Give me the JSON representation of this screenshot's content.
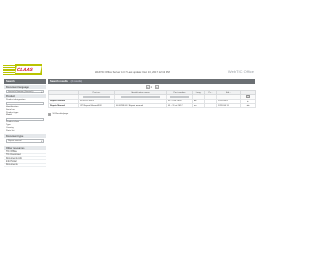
{
  "header": {
    "logo_text": "CLAAS",
    "info": "WebTIC Office Server 4.3.7  Last update: Dec 13, 2017 12:13 PM",
    "app_name": "WebTIC Office"
  },
  "sidebar": {
    "title": "Search",
    "sections": [
      {
        "title": "Document language",
        "select_value": "Deutsch/German (Deutsch)"
      },
      {
        "title": "Product",
        "fields": [
          "Product designation",
          "Identification",
          "Serial no.",
          "Product type",
          "Model",
          "Product class",
          "Type",
          "Country",
          "Parts list"
        ]
      },
      {
        "title": "Document type",
        "select_value": "Repair manual"
      },
      {
        "title": "Other resources",
        "items": [
          "TIC Offline",
          "TIC Download",
          "Documents info",
          "Info Portal",
          "Documents"
        ]
      }
    ]
  },
  "main": {
    "title": "Search results",
    "count": "(2 results)",
    "pager": {
      "first": "«",
      "current": "1",
      "next": "»"
    },
    "columns": [
      "",
      "Part no.",
      "Identification name",
      "Part number",
      "Lang.",
      "Pr...",
      "Edi...",
      ""
    ],
    "rows": [
      {
        "name": "Repair manual",
        "part": "00 0291 500 0",
        "ident": "",
        "number": "02 - 4 et 2016",
        "lang": "de",
        "prod": "",
        "date": "12/2016 8",
        "action": "▸"
      },
      {
        "name": "Repair Manual",
        "part": "CP Repair Manual/LW",
        "ident": "00 0298 00 / Repair manual",
        "number": "01 - 11 et 2017",
        "lang": "en",
        "prod": "",
        "date": "12/2016 11",
        "action": "◂ ▸"
      }
    ],
    "results_per_page": "10 Results/page"
  }
}
